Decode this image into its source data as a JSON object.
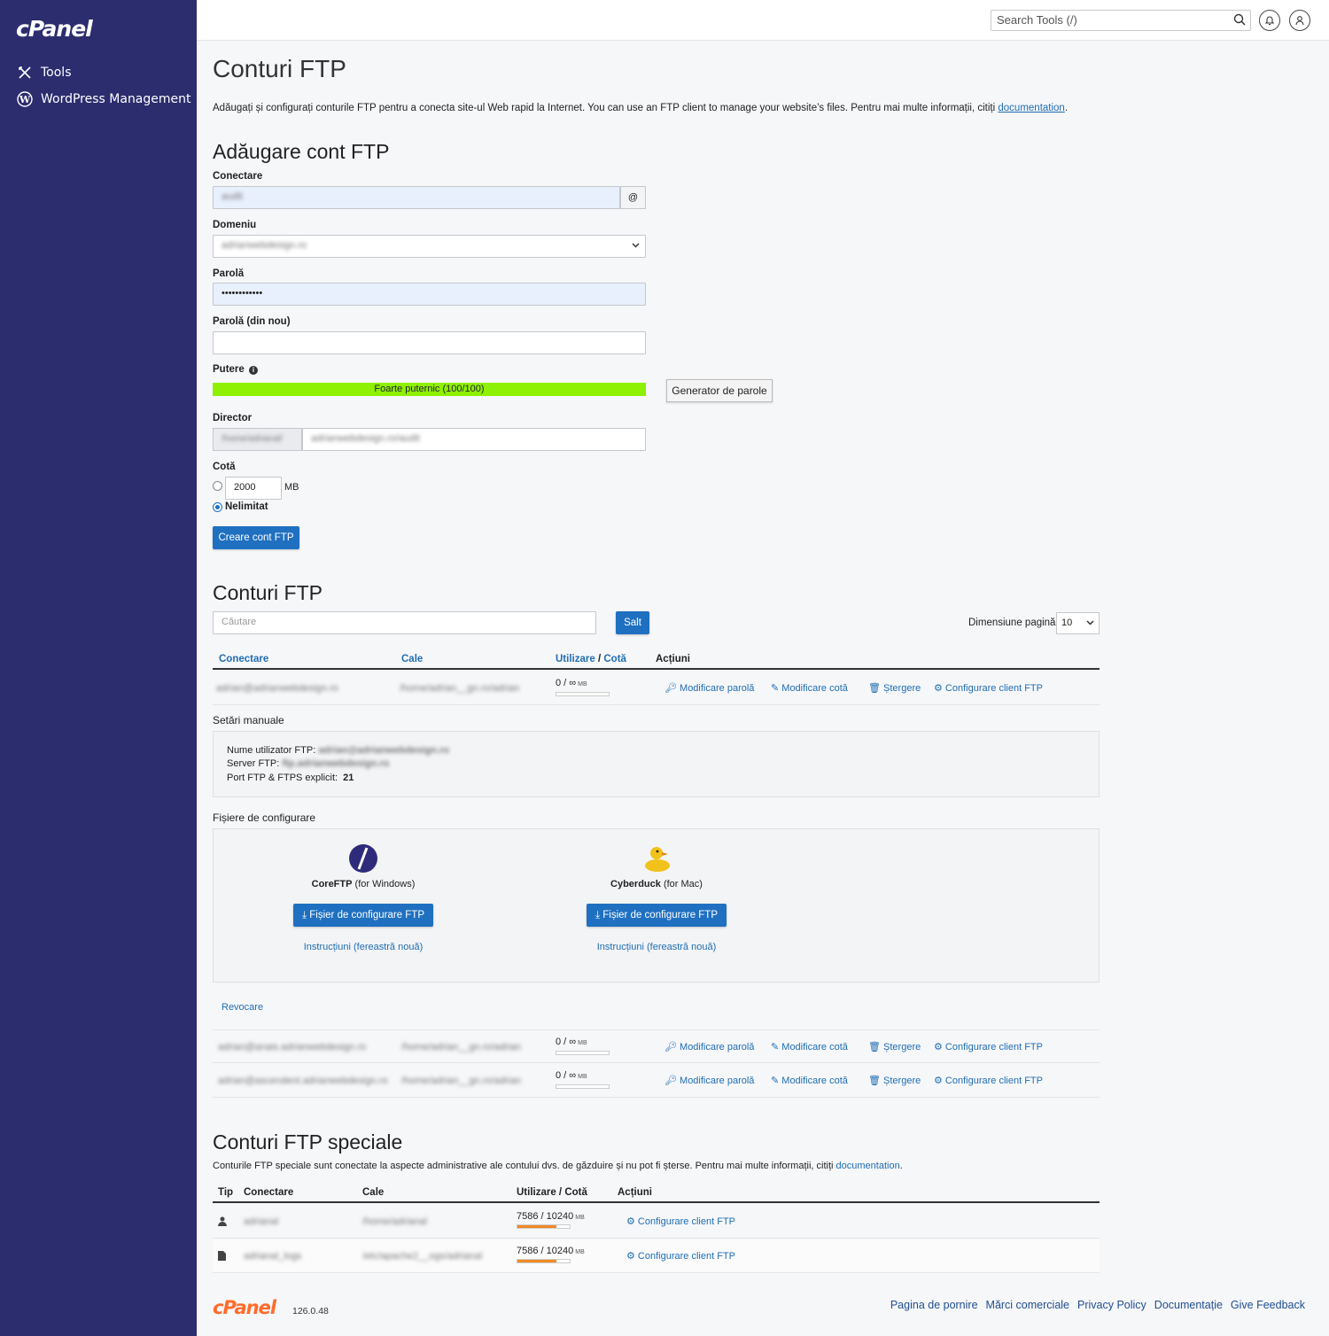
{
  "sidebar": {
    "logo": "cPanel",
    "items": [
      {
        "label": "Tools",
        "icon": "tools-icon"
      },
      {
        "label": "WordPress Management",
        "icon": "wordpress-icon"
      }
    ]
  },
  "header": {
    "search_placeholder": "Search Tools (/)"
  },
  "page": {
    "title": "Conturi FTP",
    "intro": "Adăugați și configurați conturile FTP pentru a conecta site-ul Web rapid la Internet. You can use an FTP client to manage your website’s files. Pentru mai multe informații, citiți ",
    "intro_link": "documentation",
    "intro_end": "."
  },
  "add_form": {
    "heading": "Adăugare cont FTP",
    "login_label": "Conectare",
    "login_value": "audit",
    "at_sign": "@",
    "domain_label": "Domeniu",
    "domain_value": "adrianwebdesign.ro",
    "password_label": "Parolă",
    "password_value": "••••••••••••",
    "password_again_label": "Parolă (din nou)",
    "strength_label": "Putere",
    "strength_text": "Foarte puternic (100/100)",
    "strength_value": 100,
    "generator_button": "Generator de parole",
    "directory_label": "Director",
    "directory_prefix": "/home/adrianal/",
    "directory_value": "adrianwebdesign.ro/audit",
    "quota_label": "Cotă",
    "quota_value": "2000",
    "quota_unit": "MB",
    "unlimited_label": "Nelimitat",
    "submit_button": "Creare cont FTP"
  },
  "accounts": {
    "heading": "Conturi FTP",
    "search_placeholder": "Căutare",
    "go_button": "Salt",
    "page_size_label": "Dimensiune pagină",
    "page_size_value": "10",
    "columns": {
      "login": "Conectare",
      "path": "Cale",
      "usage": "Utilizare",
      "slash": "/",
      "quota": "Cotă",
      "actions": "Acțiuni"
    },
    "rows": [
      {
        "login": "adrian@adrianwebdesign.ro",
        "path": "/home/adrian__gn.ro/adrian",
        "usage": "0 / ∞",
        "unit": "MB"
      },
      {
        "login": "adrian@anais.adrianwebdesign.ro",
        "path": "/home/adrian__gn.ro/adrian",
        "usage": "0 / ∞",
        "unit": "MB"
      },
      {
        "login": "adrian@ascendent.adrianwebdesign.ro",
        "path": "/home/adrian__gn.ro/adrian",
        "usage": "0 / ∞",
        "unit": "MB"
      }
    ],
    "actions": {
      "change_password": "Modificare parolă",
      "change_quota": "Modificare cotă",
      "delete": "Ștergere",
      "configure": "Configurare client FTP"
    },
    "manual": {
      "heading": "Setări manuale",
      "user_label": "Nume utilizator FTP:",
      "user_value": "adrian@adrianwebdesign.ro",
      "server_label": "Server FTP:",
      "server_value": "ftp.adrianwebdesign.ro",
      "port_label": "Port FTP & FTPS explicit:",
      "port_value": "21"
    },
    "config": {
      "heading": "Fișiere de configurare",
      "clients": [
        {
          "name": "CoreFTP",
          "note": "(for Windows)",
          "button": "Fișier de configurare FTP",
          "link": "Instrucțiuni (fereastră nouă)"
        },
        {
          "name": "Cyberduck",
          "note": "(for Mac)",
          "button": "Fișier de configurare FTP",
          "link": "Instrucțiuni (fereastră nouă)"
        }
      ]
    },
    "revoke": "Revocare"
  },
  "special": {
    "heading": "Conturi FTP speciale",
    "desc": "Conturile FTP speciale sunt conectate la aspecte administrative ale contului dvs. de găzduire și nu pot fi șterse. Pentru mai multe informații, citiți ",
    "desc_link": "documentation",
    "desc_end": ".",
    "columns": {
      "type": "Tip",
      "login": "Conectare",
      "path": "Cale",
      "usage": "Utilizare / Cotă",
      "actions": "Acțiuni"
    },
    "rows": [
      {
        "type_icon": "user-icon",
        "login": "adrianal",
        "path": "/home/adrianal",
        "usage": "7586 / 10240",
        "unit": "MB",
        "fraction": 0.74
      },
      {
        "type_icon": "log-file-icon",
        "login": "adrianal_logs",
        "path": "/etc/apache2__ogs/adrianal",
        "usage": "7586 / 10240",
        "unit": "MB",
        "fraction": 0.74
      }
    ],
    "configure": "Configurare client FTP"
  },
  "footer": {
    "logo": "cPanel",
    "version": "126.0.48",
    "links": [
      "Pagina de pornire",
      "Mărci comerciale",
      "Privacy Policy",
      "Documentație",
      "Give Feedback"
    ]
  }
}
